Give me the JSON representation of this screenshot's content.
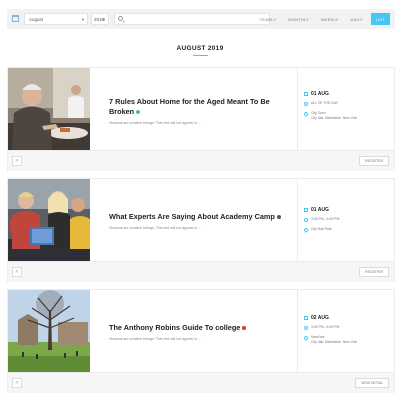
{
  "filters": {
    "month": "August",
    "year": "2019",
    "search_placeholder": ""
  },
  "views": [
    {
      "label": "YEARLY",
      "active": false
    },
    {
      "label": "MONTHLY",
      "active": false
    },
    {
      "label": "WEEKLY",
      "active": false
    },
    {
      "label": "DAILY",
      "active": false
    },
    {
      "label": "LIST",
      "active": true
    }
  ],
  "page_heading": "AUGUST 2019",
  "events": [
    {
      "title": "7 Rules About Home for the Aged Meant To Be Broken",
      "status_color": "#44c7a0",
      "description": "Humans are creative beings. This text will not appear in ...",
      "date": "01 AUG",
      "time": "ALL OF THE DAY",
      "venue": "City Town",
      "address": "City hall, Manhattan, New York",
      "action": "REGISTER"
    },
    {
      "title": "What Experts Are Saying About Academy Camp",
      "status_color": "#555555",
      "description": "Humans are creative beings. This text will not appear in ...",
      "date": "01 AUG",
      "time": "3:00 PM - 6:00 PM",
      "venue": "City Hall Park",
      "address": "",
      "action": "REGISTER"
    },
    {
      "title": "The Anthony Robins Guide To college",
      "status_color": "#d8343a",
      "description": "Humans are creative beings. This text will not appear in ...",
      "date": "02 AUG",
      "time": "3:00 PM - 6:00 PM",
      "venue": "NewYork",
      "address": "City hall, Manhattan, New York",
      "action": "VIEW DETAIL"
    }
  ],
  "colors": {
    "accent": "#44c7f4",
    "toolbar_bg": "#f2f2f2",
    "footer_bg": "#f6f6f6"
  }
}
